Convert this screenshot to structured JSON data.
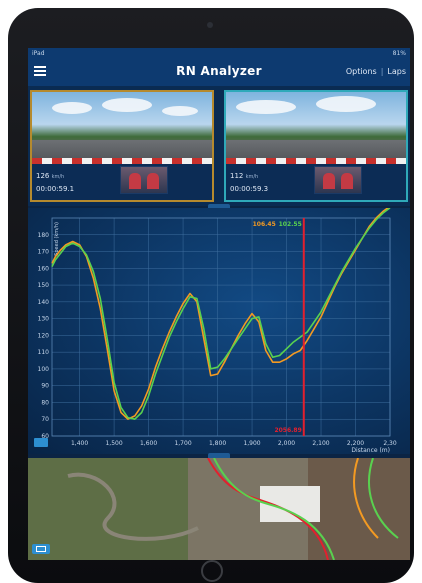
{
  "statusbar": {
    "left": "iPad",
    "right": "81%"
  },
  "app": {
    "title": "RN Analyzer"
  },
  "nav": {
    "options_label": "Options",
    "laps_label": "Laps"
  },
  "videos": [
    {
      "speed": "126",
      "unit": "km/h",
      "time": "00:00:59.1"
    },
    {
      "speed": "112",
      "unit": "km/h",
      "time": "00:00:59.3"
    }
  ],
  "chart_data": {
    "type": "line",
    "ylabel": "Speed (km/h)",
    "xlabel": "Distance (m)",
    "xlim": [
      1320,
      2300
    ],
    "ylim": [
      60,
      190
    ],
    "x_ticks": [
      1400,
      1500,
      1600,
      1700,
      1800,
      1900,
      2000,
      2100,
      2200,
      2300
    ],
    "x_tick_labels": [
      "1,400",
      "1,500",
      "1,600",
      "1,700",
      "1,800",
      "1,900",
      "2,000",
      "2,100",
      "2,200",
      "2,30"
    ],
    "y_ticks": [
      60,
      70,
      80,
      90,
      100,
      110,
      120,
      130,
      140,
      150,
      160,
      170,
      180
    ],
    "cursor": {
      "x": 2050,
      "label": "2056.89"
    },
    "readout": {
      "value1": "106.45",
      "value2": "102.55"
    },
    "colors": {
      "series1": "#f39a22",
      "series2": "#59d14f",
      "cursor": "#e3202e",
      "grid": "#3f6f9f"
    },
    "series": [
      {
        "color": "#f39a22",
        "x": [
          1320,
          1330,
          1345,
          1360,
          1380,
          1400,
          1420,
          1440,
          1460,
          1480,
          1500,
          1520,
          1540,
          1560,
          1580,
          1600,
          1620,
          1640,
          1660,
          1680,
          1700,
          1720,
          1740,
          1760,
          1780,
          1800,
          1820,
          1840,
          1860,
          1880,
          1900,
          1920,
          1940,
          1960,
          1980,
          2000,
          2020,
          2040,
          2060,
          2080,
          2100,
          2120,
          2140,
          2160,
          2180,
          2200,
          2220,
          2240,
          2260,
          2280,
          2300
        ],
        "y": [
          163,
          167,
          171,
          174,
          176,
          174,
          167,
          154,
          136,
          112,
          87,
          74,
          70,
          72,
          78,
          88,
          101,
          112,
          122,
          131,
          139,
          145,
          140,
          118,
          96,
          97,
          104,
          112,
          120,
          127,
          133,
          128,
          111,
          104,
          104,
          106,
          109,
          111,
          117,
          124,
          131,
          140,
          149,
          157,
          164,
          171,
          178,
          185,
          190,
          194,
          197
        ]
      },
      {
        "color": "#59d14f",
        "x": [
          1320,
          1330,
          1345,
          1360,
          1380,
          1400,
          1420,
          1440,
          1460,
          1480,
          1500,
          1520,
          1540,
          1560,
          1580,
          1600,
          1620,
          1640,
          1660,
          1680,
          1700,
          1720,
          1740,
          1760,
          1780,
          1800,
          1820,
          1840,
          1860,
          1880,
          1900,
          1920,
          1940,
          1960,
          1980,
          2000,
          2020,
          2040,
          2060,
          2080,
          2100,
          2120,
          2140,
          2160,
          2180,
          2200,
          2220,
          2240,
          2260,
          2280,
          2300
        ],
        "y": [
          161,
          165,
          169,
          173,
          175,
          173,
          168,
          158,
          142,
          118,
          92,
          77,
          71,
          70,
          74,
          84,
          97,
          108,
          119,
          128,
          136,
          143,
          142,
          124,
          100,
          101,
          106,
          112,
          118,
          124,
          130,
          131,
          115,
          107,
          108,
          112,
          116,
          119,
          122,
          128,
          134,
          142,
          150,
          158,
          165,
          172,
          178,
          184,
          189,
          193,
          196
        ]
      }
    ]
  }
}
